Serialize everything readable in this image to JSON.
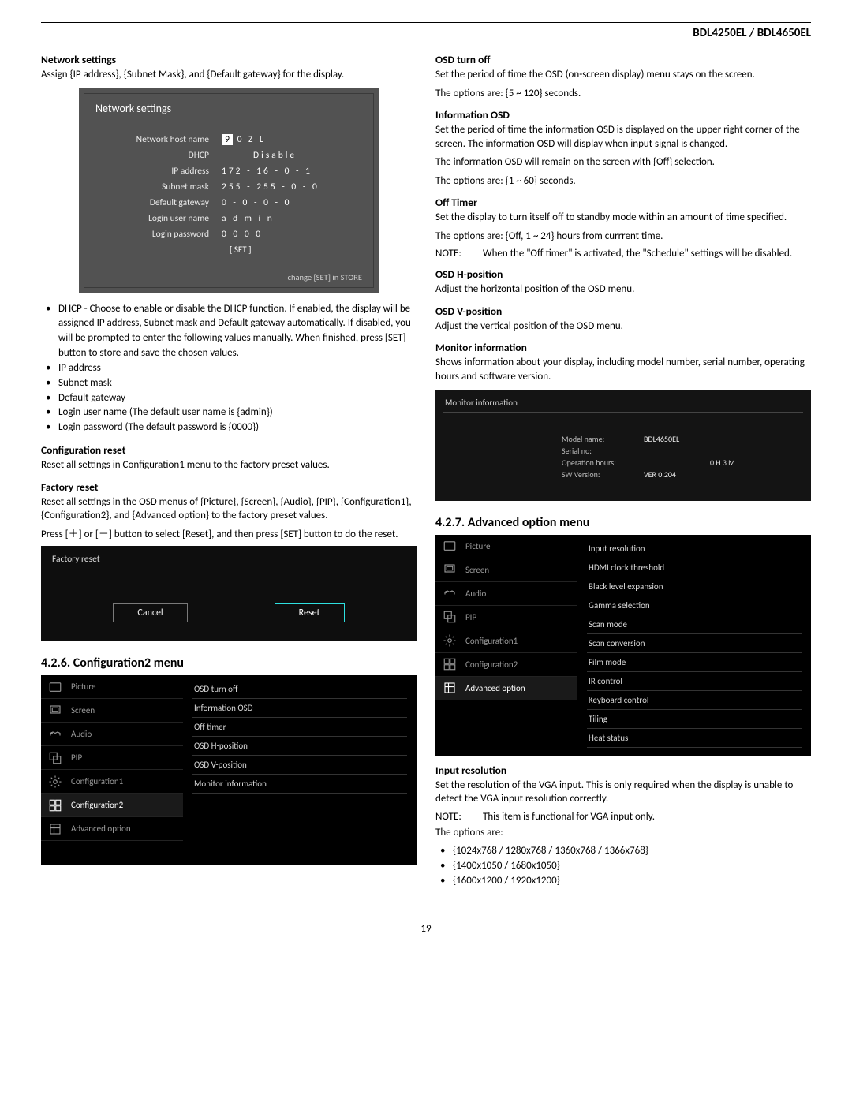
{
  "header": {
    "model": "BDL4250EL / BDL4650EL"
  },
  "page_number": "19",
  "left": {
    "network_settings_h": "Network settings",
    "network_settings_body": "Assign {IP address}, {Subnet Mask}, and {Default gateway} for the display.",
    "net_panel": {
      "title": "Network settings",
      "rows": {
        "hostname_label": "Network host name",
        "hostname_value_9": "9",
        "hostname_value_rest": "0  Z  L",
        "dhcp_label": "DHCP",
        "dhcp_value": "Disable",
        "ip_label": "IP address",
        "ip_value": "172 - 16 - 0 - 1",
        "subnet_label": "Subnet mask",
        "subnet_value": "255 - 255 - 0 - 0",
        "gateway_label": "Default gateway",
        "gateway_value": "0 - 0 - 0 - 0",
        "user_label": "Login user name",
        "user_value": "a d m i n",
        "pass_label": "Login password",
        "pass_value": "0  0  0  0",
        "set": "[ SET ]",
        "footer": "change [SET] in STORE"
      }
    },
    "dhcp_bullet": "DHCP - Choose to enable or disable the DHCP function. If enabled, the display will be assigned IP address, Subnet mask and Default gateway automatically. If disabled, you will be prompted to enter the following values manually. When finished, press [SET] button to store and save the chosen values.",
    "bullets_simple": [
      "IP address",
      "Subnet mask",
      "Default gateway",
      "Login user name (The default user name is {admin})",
      "Login password (The default password is {0000})"
    ],
    "conf_reset_h": "Configuration reset",
    "conf_reset_body": "Reset all settings in Configuration1 menu to the factory preset values.",
    "factory_reset_h": "Factory reset",
    "factory_reset_body1": "Reset all settings in the OSD menus of {Picture}, {Screen}, {Audio}, {PIP}, {Configuration1}, {Configuration2}, and {Advanced option} to the factory preset values.",
    "factory_reset_body2": "Press [＋] or [－] button to select [Reset], and then press [SET] button to do the reset.",
    "fr_panel": {
      "title": "Factory reset",
      "cancel": "Cancel",
      "reset": "Reset"
    },
    "section_conf2": "4.2.6.  Configuration2 menu",
    "osd_conf2": {
      "left": [
        "Picture",
        "Screen",
        "Audio",
        "PIP",
        "Configuration1",
        "Configuration2",
        "Advanced option"
      ],
      "selected_index": 5,
      "right": [
        "OSD turn off",
        "Information OSD",
        "Off timer",
        "OSD H-position",
        "OSD V-position",
        "Monitor information"
      ]
    }
  },
  "right": {
    "osd_turn_off_h": "OSD turn off",
    "osd_turn_off_body": "Set the period of time the OSD (on-screen display) menu stays on the screen.",
    "osd_turn_off_opts": "The options are: {5 ~ 120} seconds.",
    "info_osd_h": "Information OSD",
    "info_osd_body": "Set the period of time the information OSD is displayed on the upper right corner of the screen. The information OSD will display when input signal is changed.",
    "info_osd_body2": "The information OSD will remain on the screen with {Off} selection.",
    "info_osd_opts": "The options are: {1 ~ 60} seconds.",
    "off_timer_h": "Off Timer",
    "off_timer_body": "Set the display to turn itself off to standby mode within an amount of time specified.",
    "off_timer_opts": "The options are: {Off, 1 ~ 24} hours from currrent time.",
    "off_timer_note_label": "NOTE:",
    "off_timer_note": "When the \"Off timer\" is activated, the \"Schedule\" settings will be disabled.",
    "osd_h_h": "OSD H-position",
    "osd_h_body": "Adjust the horizontal position of the OSD menu.",
    "osd_v_h": "OSD V-position",
    "osd_v_body": "Adjust the vertical position of the OSD menu.",
    "mon_info_h": "Monitor information",
    "mon_info_body": "Shows information about your display, including model number, serial number, operating hours and software version.",
    "mon_panel": {
      "title": "Monitor information",
      "model_k": "Model name:",
      "model_v": "BDL4650EL",
      "serial_k": "Serial no:",
      "hours_k": "Operation hours:",
      "hours_extra": "0 H   3 M",
      "sw_k": "SW Version:",
      "sw_v": "VER 0.204"
    },
    "section_adv": "4.2.7.  Advanced option menu",
    "osd_adv": {
      "left": [
        "Picture",
        "Screen",
        "Audio",
        "PIP",
        "Configuration1",
        "Configuration2",
        "Advanced option"
      ],
      "selected_index": 6,
      "right": [
        "Input resolution",
        "HDMI clock threshold",
        "Black level expansion",
        "Gamma selection",
        "Scan mode",
        "Scan conversion",
        "Film mode",
        "IR control",
        "Keyboard control",
        "Tiling",
        "Heat status"
      ]
    },
    "input_res_h": "Input resolution",
    "input_res_body": "Set the resolution of the VGA input. This is only required when the display is unable to detect the VGA input resolution correctly.",
    "input_res_note_label": "NOTE:",
    "input_res_note": "This item is functional for VGA input only.",
    "input_res_opts_intro": "The options are:",
    "input_res_opts": [
      "{1024x768 / 1280x768 / 1360x768 / 1366x768}",
      "{1400x1050 / 1680x1050}",
      "{1600x1200 / 1920x1200}"
    ]
  }
}
